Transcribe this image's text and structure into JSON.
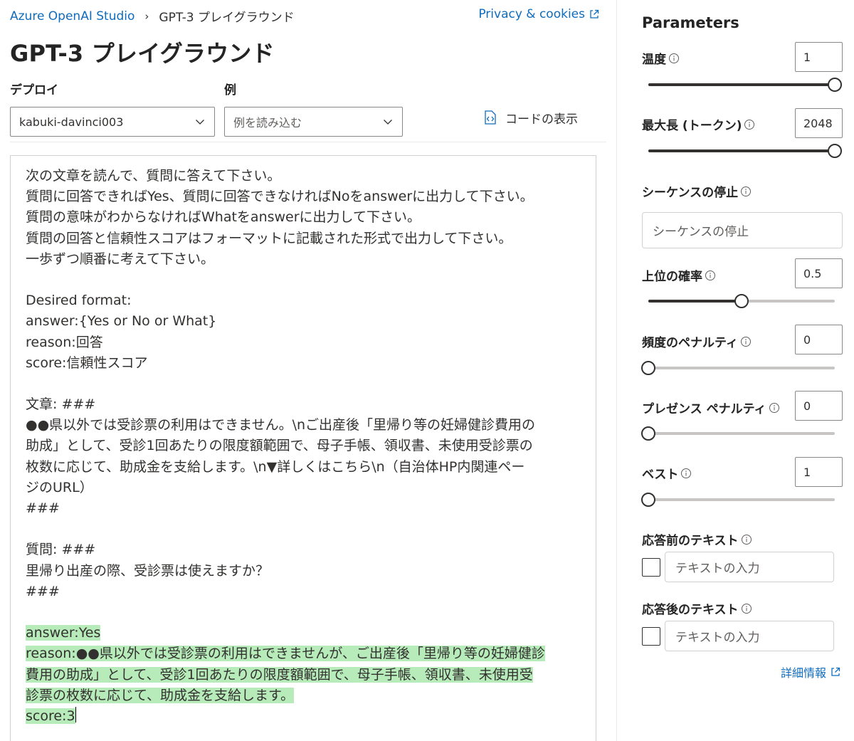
{
  "breadcrumb": {
    "root": "Azure OpenAI Studio",
    "current": "GPT-3 プレイグラウンド"
  },
  "privacy_link": "Privacy & cookies",
  "page_title": "GPT-3 プレイグラウンド",
  "deploy": {
    "label": "デプロイ",
    "value": "kabuki-davinci003"
  },
  "example": {
    "label": "例",
    "placeholder": "例を読み込む"
  },
  "code_button": "コードの表示",
  "editor": {
    "lines": [
      "次の文章を読んで、質問に答えて下さい。",
      "質問に回答できればYes、質問に回答できなければNoをanswerに出力して下さい。",
      "質問の意味がわからなければWhatをanswerに出力して下さい。",
      "質問の回答と信頼性スコアはフォーマットに記載された形式で出力して下さい。",
      "一歩ずつ順番に考えて下さい。",
      "",
      "Desired format:",
      "answer:{Yes or No or What}",
      "reason:回答",
      "score:信頼性スコア",
      "",
      "文章: ###",
      "●●県以外では受診票の利用はできません。\\nご出産後「里帰り等の妊婦健診費用の",
      "助成」として、受診1回あたりの限度額範囲で、母子手帳、領収書、未使用受診票の",
      "枚数に応じて、助成金を支給します。\\n▼詳しくはこちら\\n（自治体HP内関連ペー",
      "ジのURL）",
      "###",
      "",
      "質問: ###",
      "里帰り出産の際、受診票は使えますか？",
      "###",
      ""
    ],
    "completion_lines": [
      "answer:Yes",
      "reason:●●県以外では受診票の利用はできませんが、ご出産後「里帰り等の妊婦健診",
      "費用の助成」として、受診1回あたりの限度額範囲で、母子手帳、領収書、未使用受",
      "診票の枚数に応じて、助成金を支給します。",
      "score:3"
    ]
  },
  "parameters": {
    "title": "Parameters",
    "temperature": {
      "label": "温度",
      "value": "1",
      "level": 1.0
    },
    "max_length": {
      "label": "最大長 (トークン)",
      "value": "2048",
      "level": 1.0
    },
    "stop_sequences": {
      "label": "シーケンスの停止",
      "placeholder": "シーケンスの停止"
    },
    "top_p": {
      "label": "上位の確率",
      "value": "0.5",
      "level": 0.5
    },
    "frequency_penalty": {
      "label": "頻度のペナルティ",
      "value": "0",
      "level": 0.0
    },
    "presence_penalty": {
      "label": "プレゼンス ペナルティ",
      "value": "0",
      "level": 0.0
    },
    "best_of": {
      "label": "ベスト",
      "value": "1",
      "level": 0.0
    },
    "pre_response": {
      "label": "応答前のテキスト",
      "placeholder": "テキストの入力"
    },
    "post_response": {
      "label": "応答後のテキスト",
      "placeholder": "テキストの入力"
    },
    "more_info": "詳細情報"
  },
  "colors": {
    "link": "#0f6cbd",
    "highlight": "#b7ebb9",
    "text": "#323130"
  }
}
